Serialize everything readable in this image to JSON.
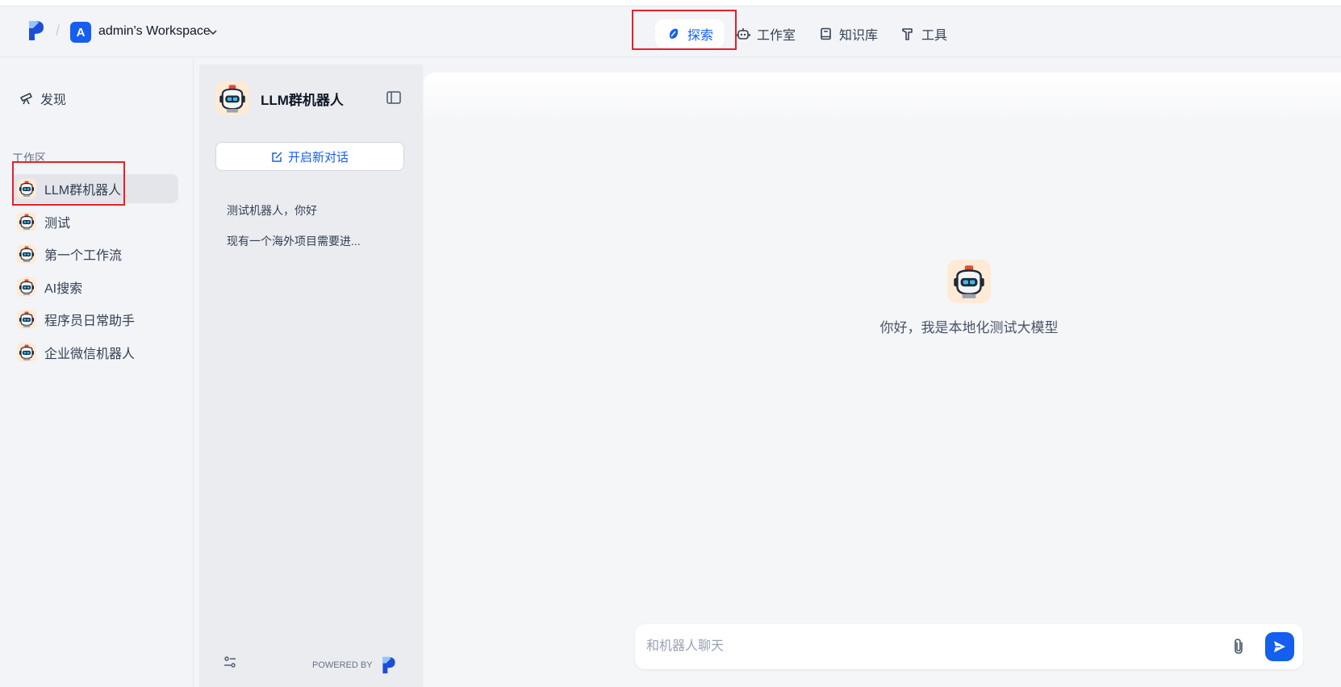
{
  "header": {
    "workspace_initial": "A",
    "workspace_name": "admin's Workspace",
    "nav": [
      {
        "label": "探索",
        "icon": "compass-icon",
        "active": true
      },
      {
        "label": "工作室",
        "icon": "robot-icon"
      },
      {
        "label": "知识库",
        "icon": "book-icon"
      },
      {
        "label": "工具",
        "icon": "hammer-icon"
      }
    ]
  },
  "sidebar": {
    "discover_label": "发现",
    "section_label": "工作区",
    "apps": [
      {
        "label": "LLM群机器人",
        "active": true
      },
      {
        "label": "测试"
      },
      {
        "label": "第一个工作流"
      },
      {
        "label": "AI搜索"
      },
      {
        "label": "程序员日常助手"
      },
      {
        "label": "企业微信机器人"
      }
    ]
  },
  "panel": {
    "title": "LLM群机器人",
    "new_chat_label": "开启新对话",
    "history": [
      "测试机器人，你好",
      "现有一个海外项目需要进..."
    ],
    "powered_by": "POWERED BY"
  },
  "main": {
    "welcome_text": "你好，我是本地化测试大模型",
    "input_placeholder": "和机器人聊天"
  },
  "colors": {
    "accent": "#155eef",
    "highlight": "#e5202b",
    "avatar_bg": "#ffead5"
  }
}
